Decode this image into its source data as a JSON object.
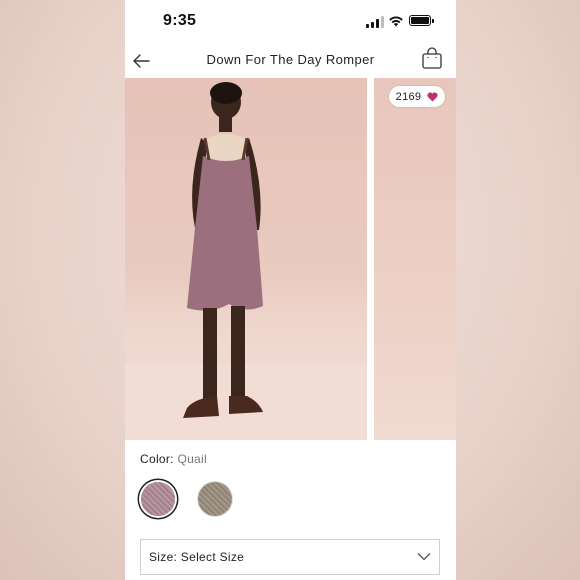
{
  "status_bar": {
    "time": "9:35"
  },
  "header": {
    "title": "Down For The Day Romper"
  },
  "gallery": {
    "likes": "2169"
  },
  "color": {
    "label": "Color:",
    "value": "Quail"
  },
  "swatches": [
    {
      "name": "Quail",
      "color": "#a98896",
      "selected": true
    },
    {
      "name": "",
      "color": "#978c7c",
      "selected": false
    }
  ],
  "size": {
    "label": "Size: Select Size"
  },
  "icons": [
    "back-arrow-icon",
    "shopping-bag-icon",
    "heart-icon",
    "chevron-down-icon",
    "signal-icon",
    "wifi-icon",
    "battery-icon"
  ],
  "colors": {
    "accent_heart": "#c0306b",
    "background": "#e9d3cb"
  }
}
